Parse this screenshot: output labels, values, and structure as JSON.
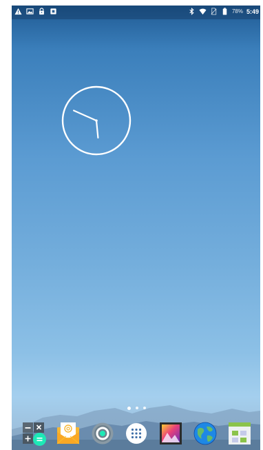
{
  "status_bar": {
    "left_icons": [
      "warning-icon",
      "image-icon",
      "lock-icon",
      "notification-icon"
    ],
    "right_icons": [
      "bluetooth-icon",
      "wifi-icon",
      "no-sim-icon",
      "battery-icon"
    ],
    "battery_percent": "78%",
    "time": "5:49"
  },
  "clock": {
    "hour": 5,
    "minute": 49
  },
  "page_indicator": {
    "pages": 3,
    "current": 0
  },
  "dock": {
    "apps": [
      {
        "name": "calculator",
        "icon": "calculator-icon",
        "color": "#1de9b6"
      },
      {
        "name": "email",
        "icon": "email-icon",
        "color": "#f7b733"
      },
      {
        "name": "settings",
        "icon": "settings-icon",
        "color": "#8a9aa5"
      },
      {
        "name": "all-apps",
        "icon": "app-drawer-icon",
        "color": "#ffffff"
      },
      {
        "name": "gallery",
        "icon": "gallery-icon",
        "color": "#d8346a"
      },
      {
        "name": "browser",
        "icon": "globe-icon",
        "color": "#1e88e5"
      },
      {
        "name": "file-manager",
        "icon": "folder-icon",
        "color": "#8bc34a"
      }
    ]
  },
  "colors": {
    "wallpaper_top": "#1f5a93",
    "wallpaper_bottom": "#a4cfee",
    "status_text": "#ffffff"
  }
}
